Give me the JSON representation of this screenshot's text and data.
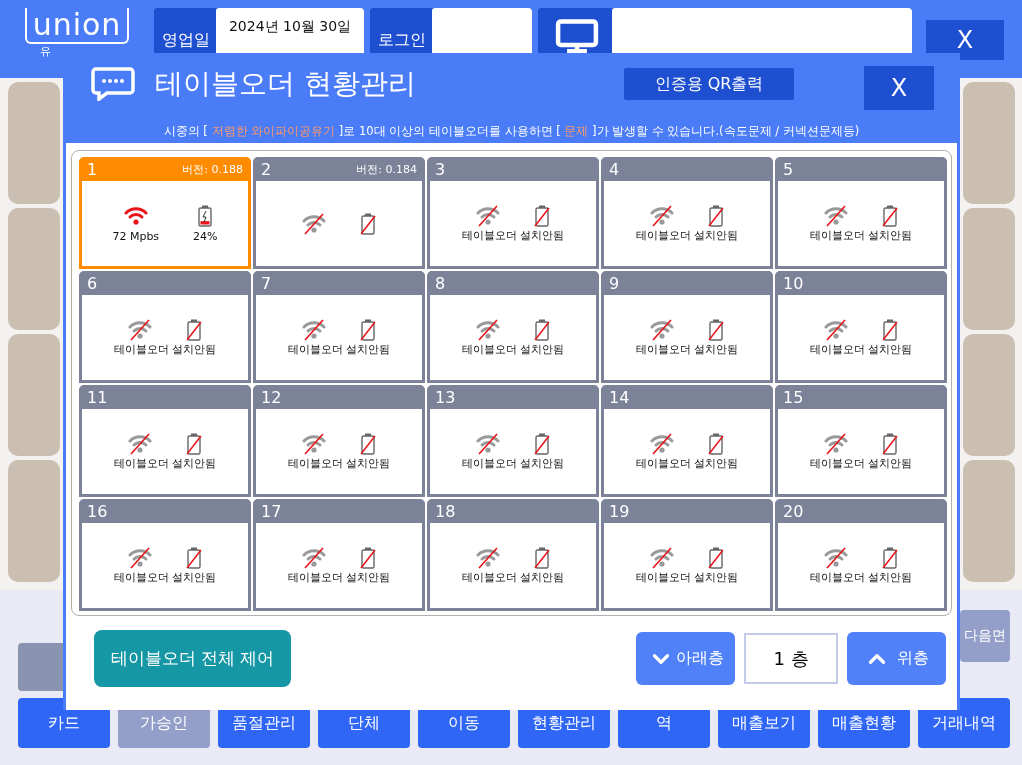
{
  "header": {
    "logo": "union",
    "logo_sub": "유",
    "business_day_label": "영업일",
    "date": "2024년 10월 30일",
    "login_label": "로그인",
    "close": "X"
  },
  "background": {
    "next_page": "다음면",
    "buttons": [
      {
        "label": "카드",
        "disabled": false
      },
      {
        "label": "가승인",
        "disabled": true
      },
      {
        "label": "품절관리",
        "disabled": false
      },
      {
        "label": "단체",
        "disabled": false
      },
      {
        "label": "이동",
        "disabled": false
      },
      {
        "label": "현황관리",
        "disabled": false
      },
      {
        "label": "역",
        "disabled": false
      },
      {
        "label": "매출보기",
        "disabled": false
      },
      {
        "label": "매출현황",
        "disabled": false
      },
      {
        "label": "거래내역",
        "disabled": false
      }
    ]
  },
  "modal": {
    "title": "테이블오더 현황관리",
    "qr_button": "인증용 QR출력",
    "close": "X",
    "notice": [
      {
        "text": "시중의 [ ",
        "highlight": false
      },
      {
        "text": "저렴한 와이파이공유기",
        "highlight": true
      },
      {
        "text": " ]로 10대 이상의 테이블오더를 사용하면 [ ",
        "highlight": false
      },
      {
        "text": "문제",
        "highlight": true
      },
      {
        "text": " ]가 발생할 수 있습니다.(속도문제 / 커넥션문제등)",
        "highlight": false
      }
    ],
    "tables": [
      {
        "number": "1",
        "selected": true,
        "version": "버전: 0.188",
        "kind": "connected",
        "speed": "72 Mpbs",
        "battery": "24%",
        "level": 0.24
      },
      {
        "number": "2",
        "selected": false,
        "version": "버전: 0.184",
        "kind": "offline"
      },
      {
        "number": "3",
        "selected": false,
        "kind": "offline",
        "caption": "테이블오더 설치안됨"
      },
      {
        "number": "4",
        "selected": false,
        "kind": "offline",
        "caption": "테이블오더 설치안됨"
      },
      {
        "number": "5",
        "selected": false,
        "kind": "offline",
        "caption": "테이블오더 설치안됨"
      },
      {
        "number": "6",
        "selected": false,
        "kind": "offline",
        "caption": "테이블오더 설치안됨"
      },
      {
        "number": "7",
        "selected": false,
        "kind": "offline",
        "caption": "테이블오더 설치안됨"
      },
      {
        "number": "8",
        "selected": false,
        "kind": "offline",
        "caption": "테이블오더 설치안됨"
      },
      {
        "number": "9",
        "selected": false,
        "kind": "offline",
        "caption": "테이블오더 설치안됨"
      },
      {
        "number": "10",
        "selected": false,
        "kind": "offline",
        "caption": "테이블오더 설치안됨"
      },
      {
        "number": "11",
        "selected": false,
        "kind": "offline",
        "caption": "테이블오더 설치안됨"
      },
      {
        "number": "12",
        "selected": false,
        "kind": "offline",
        "caption": "테이블오더 설치안됨"
      },
      {
        "number": "13",
        "selected": false,
        "kind": "offline",
        "caption": "테이블오더 설치안됨"
      },
      {
        "number": "14",
        "selected": false,
        "kind": "offline",
        "caption": "테이블오더 설치안됨"
      },
      {
        "number": "15",
        "selected": false,
        "kind": "offline",
        "caption": "테이블오더 설치안됨"
      },
      {
        "number": "16",
        "selected": false,
        "kind": "offline",
        "caption": "테이블오더 설치안됨"
      },
      {
        "number": "17",
        "selected": false,
        "kind": "offline",
        "caption": "테이블오더 설치안됨"
      },
      {
        "number": "18",
        "selected": false,
        "kind": "offline",
        "caption": "테이블오더 설치안됨"
      },
      {
        "number": "19",
        "selected": false,
        "kind": "offline",
        "caption": "테이블오더 설치안됨"
      },
      {
        "number": "20",
        "selected": false,
        "kind": "offline",
        "caption": "테이블오더 설치안됨"
      }
    ],
    "control_all": "테이블오더 전체 제어",
    "floor_down": "아래층",
    "floor": "1 층",
    "floor_up": "위층"
  }
}
